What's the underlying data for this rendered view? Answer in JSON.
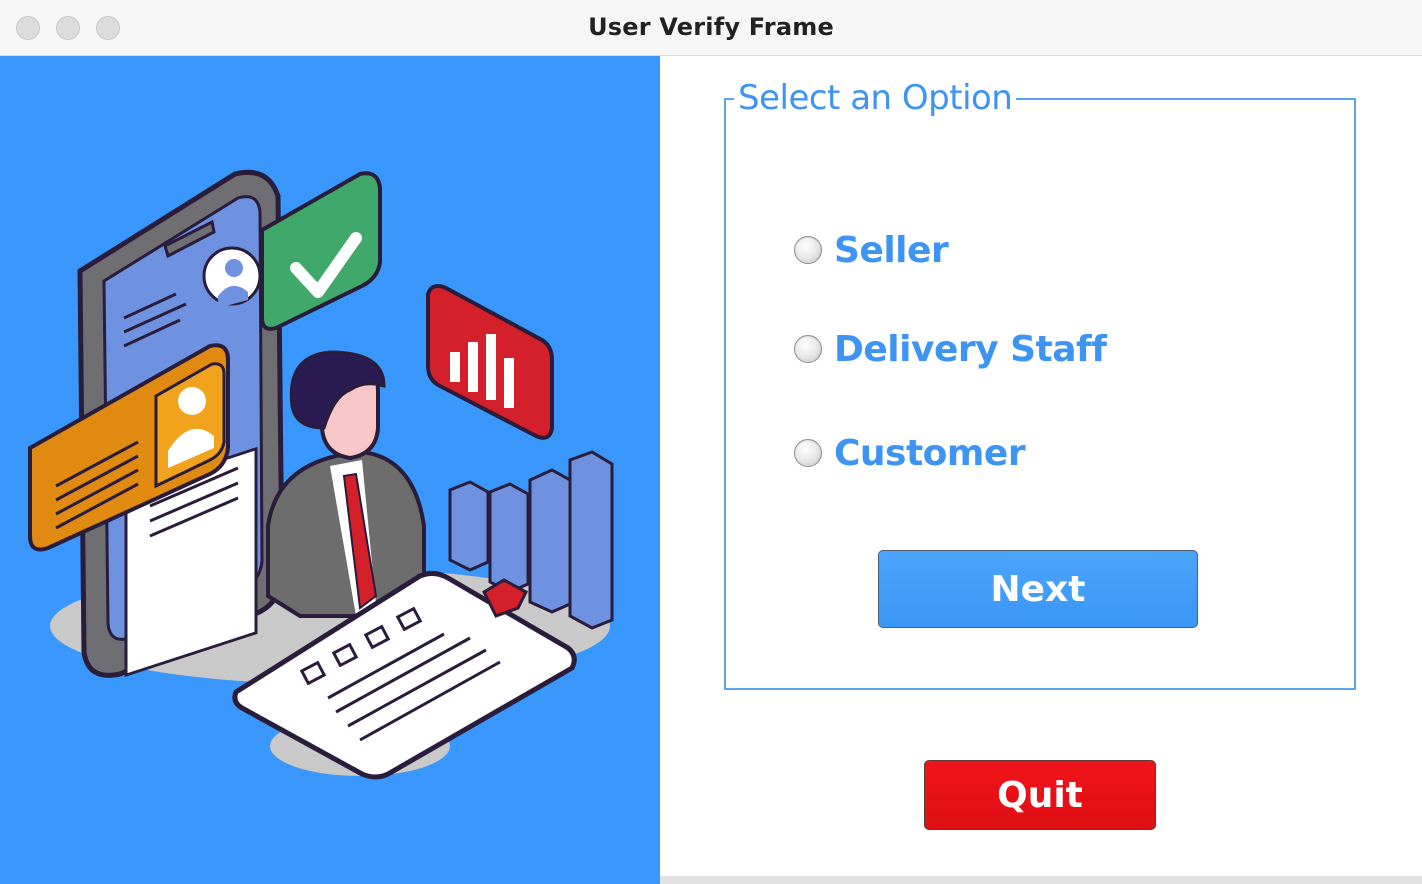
{
  "window": {
    "title": "User Verify Frame"
  },
  "options": {
    "legend": "Select an Option",
    "items": [
      {
        "label": "Seller",
        "selected": false
      },
      {
        "label": "Delivery Staff",
        "selected": false
      },
      {
        "label": "Customer",
        "selected": false
      }
    ]
  },
  "buttons": {
    "next_label": "Next",
    "quit_label": "Quit"
  },
  "colors": {
    "illustration_bg": "#3a97fb",
    "accent_blue": "#3d94f2",
    "next_button": "#3b97f6",
    "quit_button": "#e8121a"
  }
}
